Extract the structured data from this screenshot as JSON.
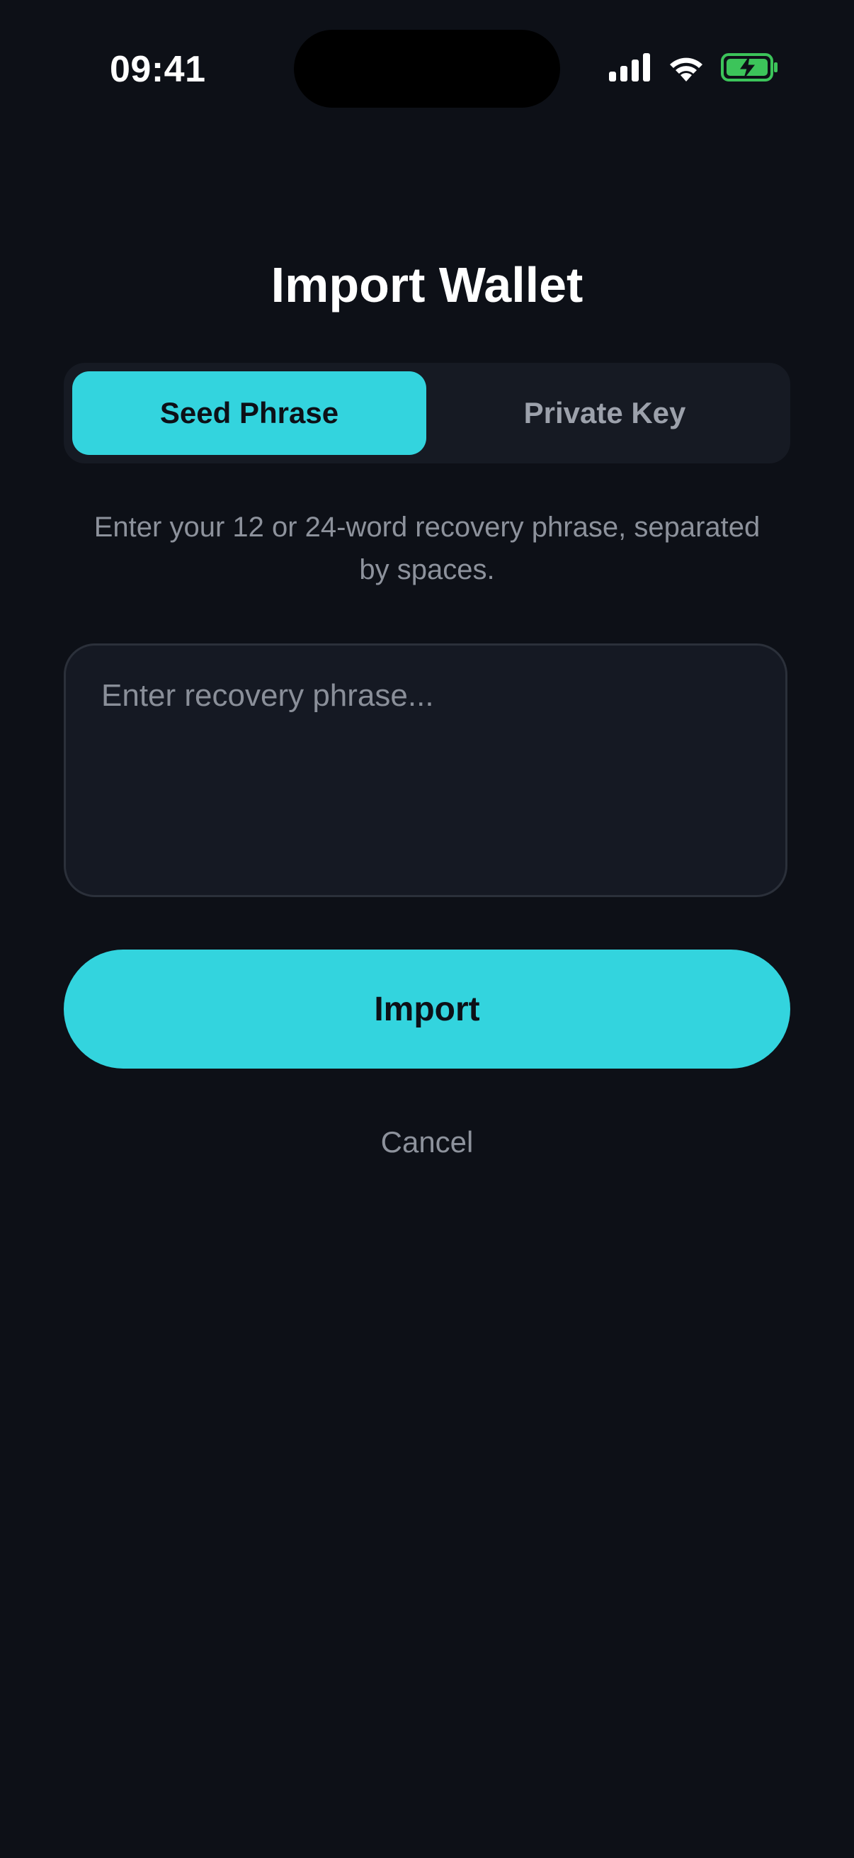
{
  "status_bar": {
    "time": "09:41",
    "icons": [
      "cellular-signal-icon",
      "wifi-icon",
      "battery-charging-icon"
    ],
    "battery_color": "#3cc45a"
  },
  "title": "Import Wallet",
  "tabs": [
    {
      "label": "Seed Phrase",
      "selected": true
    },
    {
      "label": "Private Key",
      "selected": false
    }
  ],
  "instruction": "Enter your 12 or 24-word recovery phrase, separated by spaces.",
  "phrase_input": {
    "value": "",
    "placeholder": "Enter recovery phrase..."
  },
  "import_label": "Import",
  "cancel_label": "Cancel",
  "colors": {
    "background": "#0d1017",
    "accent": "#33d4de",
    "muted_text": "#8d929c"
  }
}
